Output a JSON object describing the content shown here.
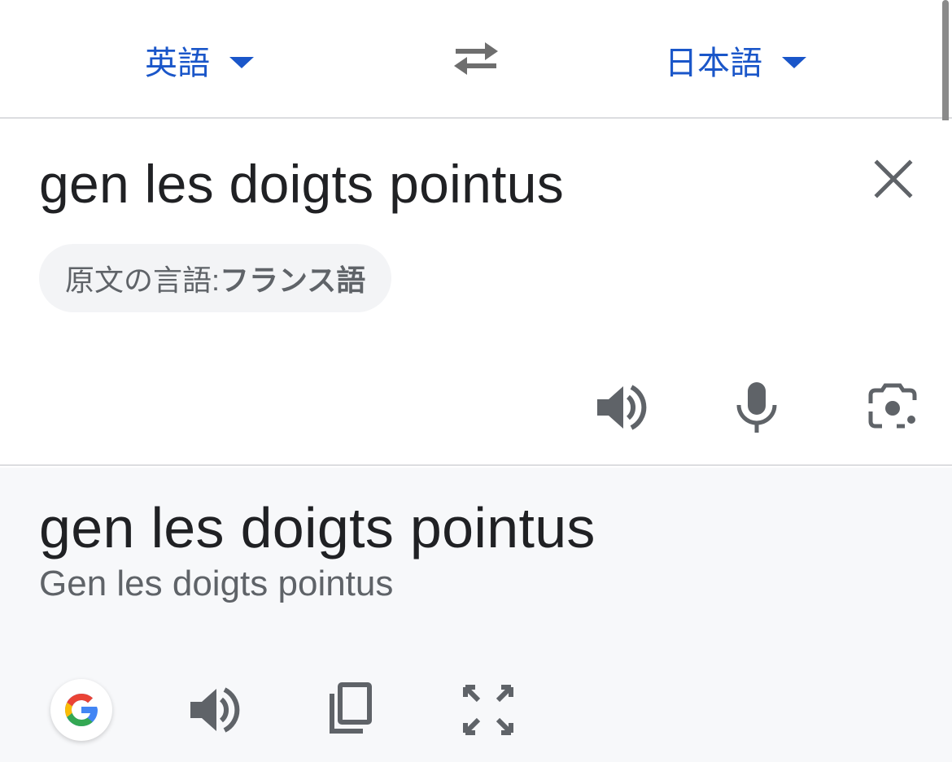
{
  "languages": {
    "source": "英語",
    "target": "日本語"
  },
  "input": {
    "text": "gen les doigts pointus",
    "detected_prefix": "原文の言語: ",
    "detected_language": "フランス語"
  },
  "output": {
    "translation": "gen les doigts pointus",
    "transliteration": "Gen les doigts pointus"
  },
  "icons": {
    "swap": "swap-arrows-icon",
    "clear": "close-icon",
    "speak": "speaker-icon",
    "mic": "microphone-icon",
    "camera": "camera-lens-icon",
    "google": "google-g-icon",
    "copy": "copy-icon",
    "expand": "fullscreen-icon"
  },
  "colors": {
    "accent": "#1a56c9",
    "icon": "#5f6368",
    "output_bg": "#f7f8fa",
    "chip_bg": "#f3f4f6"
  }
}
